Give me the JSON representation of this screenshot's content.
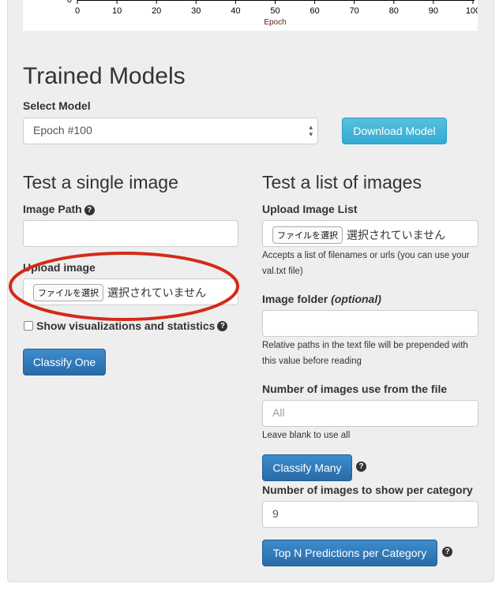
{
  "chart_data": {
    "type": "line",
    "x_ticks": [
      0,
      10,
      20,
      30,
      40,
      50,
      60,
      70,
      80,
      90,
      100
    ],
    "y_ticks_visible": [
      0
    ],
    "xlabel": "Epoch",
    "xlim": [
      0,
      100
    ]
  },
  "title": "Trained Models",
  "select_model": {
    "label": "Select Model",
    "value": "Epoch #100"
  },
  "download_button": "Download Model",
  "single": {
    "title": "Test a single image",
    "image_path_label": "Image Path",
    "upload_label": "Upload image",
    "file_button": "ファイルを選択",
    "file_status": "選択されていません",
    "checkbox_label": "Show visualizations and statistics",
    "classify_button": "Classify One"
  },
  "list": {
    "title": "Test a list of images",
    "upload_label": "Upload Image List",
    "file_button": "ファイルを選択",
    "file_status": "選択されていません",
    "upload_help": "Accepts a list of filenames or urls (you can use your val.txt file)",
    "folder_label": "Image folder",
    "folder_optional": "(optional)",
    "folder_help": "Relative paths in the text file will be prepended with this value before reading",
    "num_label": "Number of images use from the file",
    "num_placeholder": "All",
    "num_help": "Leave blank to use all",
    "classify_button": "Classify Many",
    "per_cat_label": "Number of images to show per category",
    "per_cat_value": "9",
    "topn_button": "Top N Predictions per Category"
  },
  "help_glyph": "?",
  "annotation_color": "#d42a1a"
}
